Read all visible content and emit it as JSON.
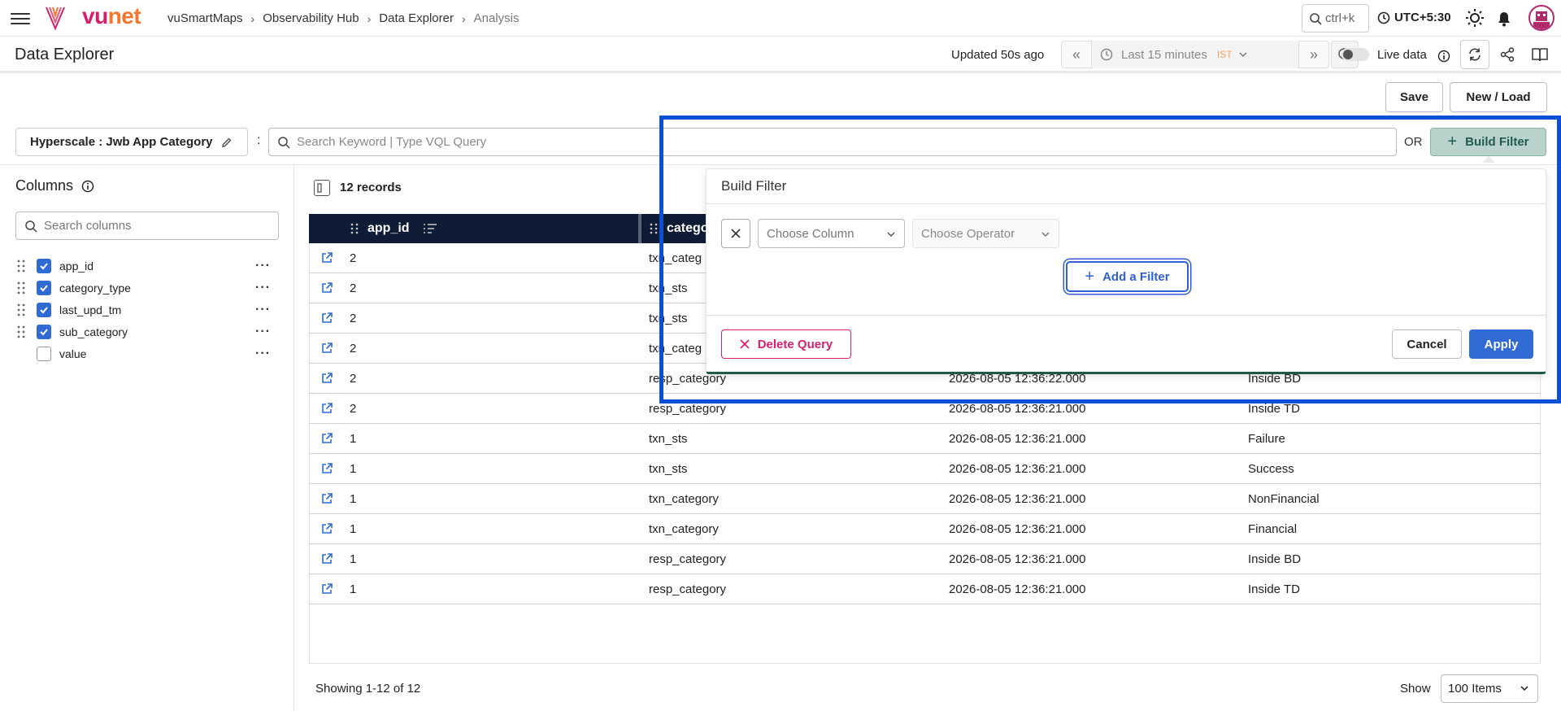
{
  "brand": {
    "vu": "vu",
    "net": "net"
  },
  "breadcrumb": [
    "vuSmartMaps",
    "Observability Hub",
    "Data Explorer",
    "Analysis"
  ],
  "search_shortcut": "ctrl+k",
  "timezone": "UTC+5:30",
  "page_title": "Data Explorer",
  "updated": "Updated 50s ago",
  "time_range": {
    "label": "Last 15 minutes",
    "tz": "IST"
  },
  "live_data": {
    "label": "Live data",
    "enabled": false
  },
  "toolbar": {
    "save": "Save",
    "new_load": "New / Load"
  },
  "dataset": "Hyperscale : Jwb App Category",
  "query": {
    "placeholder": "Search Keyword | Type VQL Query",
    "value": ""
  },
  "or_label": "OR",
  "build_filter_label": "Build Filter",
  "columns_panel": {
    "title": "Columns",
    "search_placeholder": "Search columns",
    "items": [
      {
        "name": "app_id",
        "checked": true
      },
      {
        "name": "category_type",
        "checked": true
      },
      {
        "name": "last_upd_tm",
        "checked": true
      },
      {
        "name": "sub_category",
        "checked": true
      },
      {
        "name": "value",
        "checked": false
      }
    ]
  },
  "records": "12 records",
  "table": {
    "headers": [
      "app_id",
      "catego"
    ],
    "rows": [
      {
        "app_id": "2",
        "category": "txn_categ",
        "time": "",
        "sub": ""
      },
      {
        "app_id": "2",
        "category": "txn_sts",
        "time": "",
        "sub": ""
      },
      {
        "app_id": "2",
        "category": "txn_sts",
        "time": "",
        "sub": ""
      },
      {
        "app_id": "2",
        "category": "txn_categ",
        "time": "",
        "sub": ""
      },
      {
        "app_id": "2",
        "category": "resp_category",
        "time": "2026-08-05 12:36:22.000",
        "sub": "Inside BD"
      },
      {
        "app_id": "2",
        "category": "resp_category",
        "time": "2026-08-05 12:36:21.000",
        "sub": "Inside TD"
      },
      {
        "app_id": "1",
        "category": "txn_sts",
        "time": "2026-08-05 12:36:21.000",
        "sub": "Failure"
      },
      {
        "app_id": "1",
        "category": "txn_sts",
        "time": "2026-08-05 12:36:21.000",
        "sub": "Success"
      },
      {
        "app_id": "1",
        "category": "txn_category",
        "time": "2026-08-05 12:36:21.000",
        "sub": "NonFinancial"
      },
      {
        "app_id": "1",
        "category": "txn_category",
        "time": "2026-08-05 12:36:21.000",
        "sub": "Financial"
      },
      {
        "app_id": "1",
        "category": "resp_category",
        "time": "2026-08-05 12:36:21.000",
        "sub": "Inside BD"
      },
      {
        "app_id": "1",
        "category": "resp_category",
        "time": "2026-08-05 12:36:21.000",
        "sub": "Inside TD"
      }
    ]
  },
  "pagination": {
    "showing": "Showing 1-12 of 12",
    "show_label": "Show",
    "items_per_page": "100 Items"
  },
  "build_filter_popover": {
    "title": "Build Filter",
    "column_placeholder": "Choose Column",
    "operator_placeholder": "Choose Operator",
    "add_filter": "Add a Filter",
    "delete_query": "Delete Query",
    "cancel": "Cancel",
    "apply": "Apply"
  },
  "colors": {
    "brand_pink": "#d5216b",
    "brand_orange": "#f2762e",
    "primary": "#2f6bd3",
    "header_bg": "#0f1c35",
    "highlight": "#0a4fd8"
  }
}
